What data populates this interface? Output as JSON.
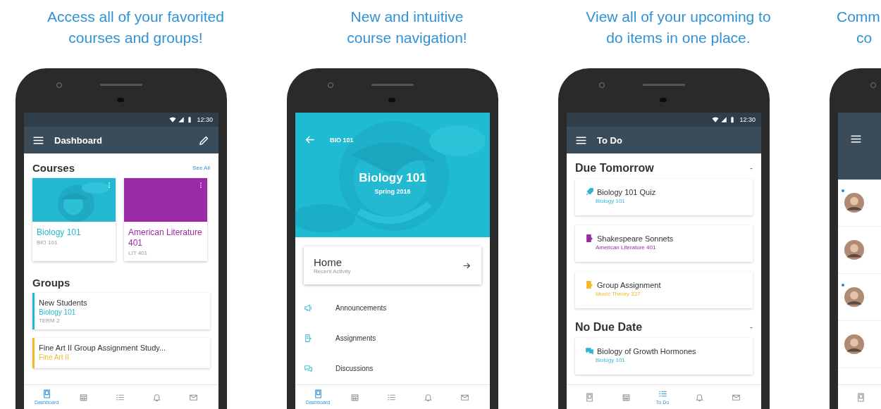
{
  "panels": [
    {
      "kind": "dashboard",
      "caption": [
        "Access all of your favorited",
        "courses and groups!"
      ],
      "status": {
        "time": "12:30"
      },
      "toolbar": {
        "title": "Dashboard"
      },
      "courses_heading": "Courses",
      "see_all": "See All",
      "courses": [
        {
          "kind": "picture",
          "name": "Biology 101",
          "code": "BIO 101",
          "color": "#22b8d1"
        },
        {
          "kind": "plain",
          "name": "American Literature 401",
          "code": "LIT 401",
          "color": "#9b2aa6"
        }
      ],
      "groups_heading": "Groups",
      "groups": [
        {
          "name": "New Students",
          "course": "Biology 101",
          "term": "TERM 2",
          "color": "#22b8d1"
        },
        {
          "name": "Fine Art II Group Assignment Study...",
          "course": "Fine Art II",
          "color": "#f3b82b"
        }
      ],
      "tabs": [
        {
          "kind": "dashboard",
          "label": "Dashboard",
          "selected": true
        },
        {
          "kind": "calendar",
          "selected": false
        },
        {
          "kind": "todo",
          "selected": false
        },
        {
          "kind": "notifications",
          "selected": false
        },
        {
          "kind": "inbox",
          "selected": false
        }
      ]
    },
    {
      "kind": "course",
      "caption": [
        "New and intuitive",
        "course navigation!"
      ],
      "code": "BIO 101",
      "title": "Biology 101",
      "term": "Spring 2016",
      "home": {
        "title": "Home",
        "subtitle": "Recent Activity"
      },
      "items": [
        {
          "kind": "announcements",
          "label": "Announcements"
        },
        {
          "kind": "assignments",
          "label": "Assignments"
        },
        {
          "kind": "discussions",
          "label": "Discussions"
        }
      ],
      "tabs": [
        {
          "kind": "dashboard",
          "label": "Dashboard",
          "selected": true
        },
        {
          "kind": "calendar",
          "selected": false
        },
        {
          "kind": "todo",
          "selected": false
        },
        {
          "kind": "notifications",
          "selected": false
        },
        {
          "kind": "inbox",
          "selected": false
        }
      ]
    },
    {
      "kind": "todo",
      "caption": [
        "View all of your upcoming to",
        "do items in one place."
      ],
      "status": {
        "time": "12:30"
      },
      "toolbar": {
        "title": "To Do"
      },
      "sections": [
        {
          "title": "Due Tomorrow",
          "toggle": "-",
          "items": [
            {
              "kind": "quiz",
              "title": "Biology 101 Quiz",
              "course": "Biology 101",
              "color": "#2fb5d6"
            },
            {
              "kind": "assignment",
              "title": "Shakespeare Sonnets",
              "course": "American Literature 401",
              "color": "#9b2aa6"
            },
            {
              "kind": "assignment",
              "title": "Group Assignment",
              "course": "Music Theory 337",
              "color": "#f3b82b"
            }
          ]
        },
        {
          "title": "No Due Date",
          "toggle": "-",
          "items": [
            {
              "kind": "discussion",
              "title": "Biology of Growth Hormones",
              "course": "Biology 101",
              "color": "#2fb5d6"
            }
          ]
        }
      ],
      "tabs": [
        {
          "kind": "dashboard",
          "selected": false
        },
        {
          "kind": "calendar",
          "selected": false
        },
        {
          "kind": "todo",
          "label": "To Do",
          "selected": true
        },
        {
          "kind": "notifications",
          "selected": false
        },
        {
          "kind": "inbox",
          "selected": false
        }
      ]
    },
    {
      "kind": "inbox",
      "caption": [
        "Comm",
        "co"
      ],
      "rows": [
        {
          "unread": true
        },
        {
          "unread": false
        },
        {
          "unread": true
        },
        {
          "unread": false
        }
      ],
      "tabs": [
        {
          "kind": "dashboard",
          "selected": false
        }
      ]
    }
  ]
}
